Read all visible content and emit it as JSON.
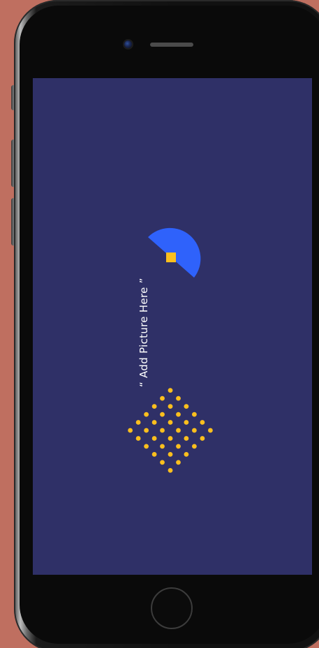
{
  "screen": {
    "placeholder_text": "“ Add Picture Here ”"
  },
  "colors": {
    "background": "#bf6f60",
    "screen": "#2f3067",
    "accent_blue": "#2f62fb",
    "accent_yellow": "#fbbf1e",
    "text": "#ffffff"
  },
  "icons": {
    "half_circle": "blue-quarter-circle-shape",
    "square": "yellow-square-shape",
    "dot_grid": "yellow-dot-grid-shape"
  }
}
